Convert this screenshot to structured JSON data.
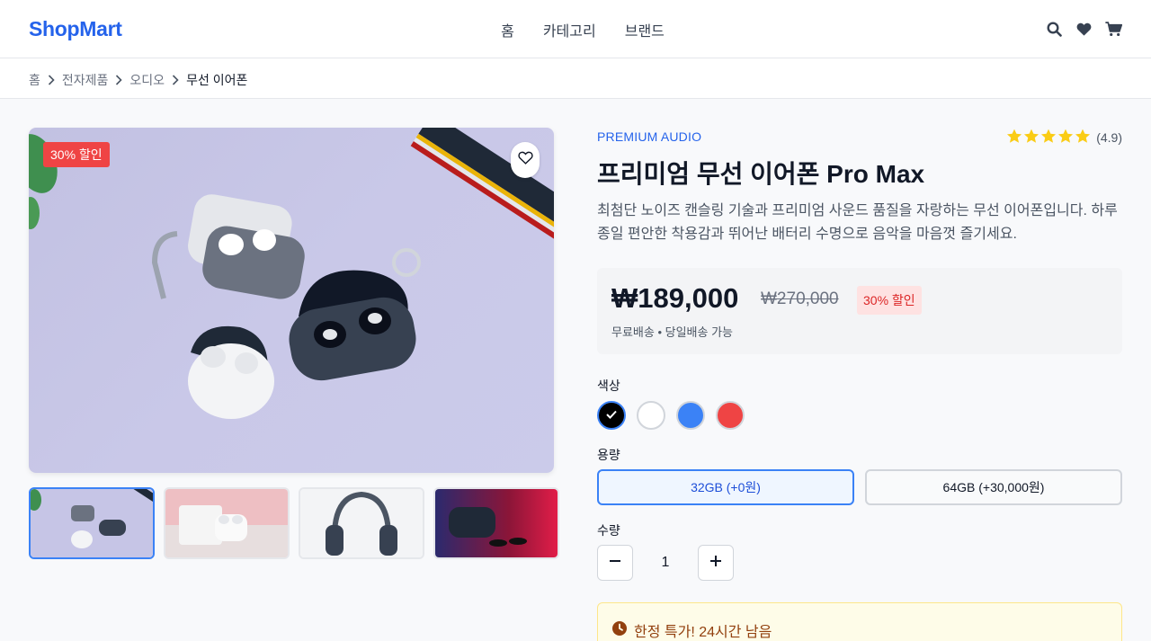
{
  "header": {
    "logo": "ShopMart",
    "nav": [
      "홈",
      "카테고리",
      "브랜드"
    ],
    "icons": [
      "search-icon",
      "heart-icon",
      "cart-icon"
    ]
  },
  "breadcrumb": [
    "홈",
    "전자제품",
    "오디오",
    "무선 이어폰"
  ],
  "gallery": {
    "badge": "30% 할인",
    "thumbnails": [
      "earbuds-cases",
      "white-earbuds-box",
      "headphones",
      "earbuds-dark-case"
    ],
    "selected_thumbnail": 0
  },
  "product": {
    "brand": "PREMIUM AUDIO",
    "rating": "(4.9)",
    "stars": 5,
    "title": "프리미엄 무선 이어폰 Pro Max",
    "description": "최첨단 노이즈 캔슬링 기술과 프리미엄 사운드 품질을 자랑하는 무선 이어폰입니다. 하루 종일 편안한 착용감과 뛰어난 배터리 수명으로 음악을 마음껏 즐기세요.",
    "price": "₩189,000",
    "old_price": "₩270,000",
    "discount": "30% 할인",
    "shipping": "무료배송 • 당일배송 가능"
  },
  "options": {
    "color_label": "색상",
    "colors": [
      "#000000",
      "#ffffff",
      "#3b82f6",
      "#ef4444"
    ],
    "selected_color": 0,
    "capacity_label": "용량",
    "capacities": [
      "32GB (+0원)",
      "64GB (+30,000원)"
    ],
    "selected_capacity": 0,
    "quantity_label": "수량",
    "quantity": "1"
  },
  "deal": {
    "text": "한정 특가! 24시간 남음"
  },
  "colors": {
    "accent": "#2563eb",
    "sale": "#ef4444",
    "star": "#facc15"
  }
}
